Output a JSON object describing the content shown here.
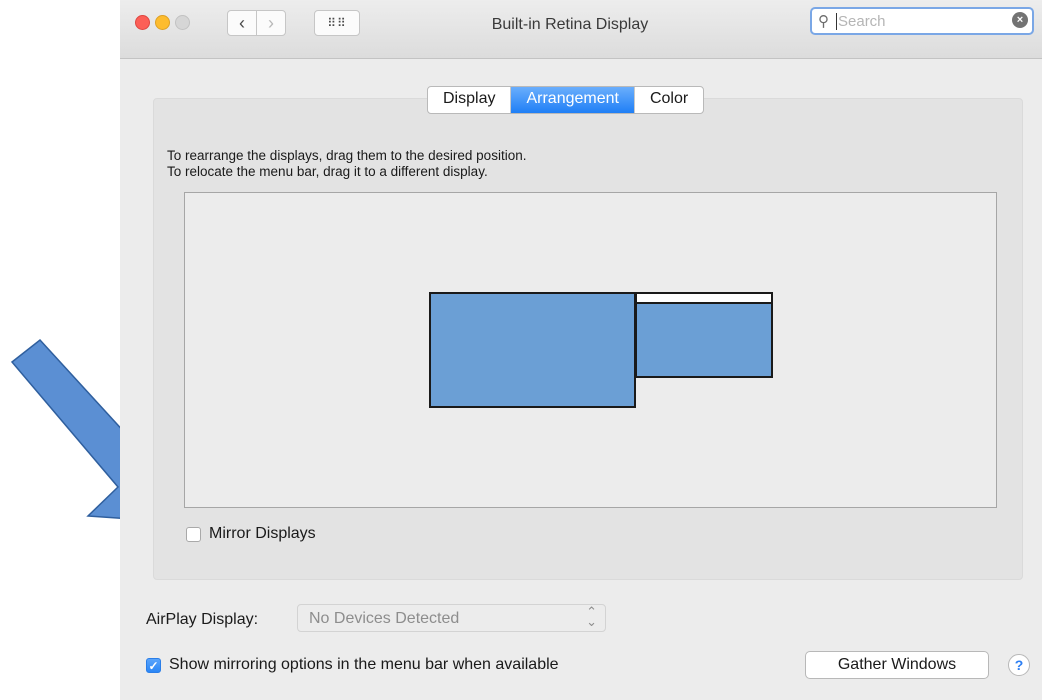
{
  "window": {
    "title": "Built-in Retina Display",
    "nav_back_glyph": "‹",
    "nav_forward_glyph": "›",
    "grid_glyph": "⠿⠿"
  },
  "search": {
    "placeholder": "Search",
    "clear_glyph": "×"
  },
  "tabs": [
    {
      "label": "Display",
      "active": false
    },
    {
      "label": "Arrangement",
      "active": true
    },
    {
      "label": "Color",
      "active": false
    }
  ],
  "arrangement": {
    "instruction_line1": "To rearrange the displays, drag them to the desired position.",
    "instruction_line2": "To relocate the menu bar, drag it to a different display.",
    "mirror_label": "Mirror Displays",
    "mirror_checked": false
  },
  "airplay": {
    "label": "AirPlay Display:",
    "value": "No Devices Detected"
  },
  "show_mirroring": {
    "label": "Show mirroring options in the menu bar when available",
    "checked": true,
    "check_glyph": "✓"
  },
  "buttons": {
    "gather_windows": "Gather Windows",
    "help": "?"
  },
  "colors": {
    "accent": "#2a86f6",
    "display_fill": "#6b9fd5",
    "annotation_arrow": "#5b8fd3"
  }
}
